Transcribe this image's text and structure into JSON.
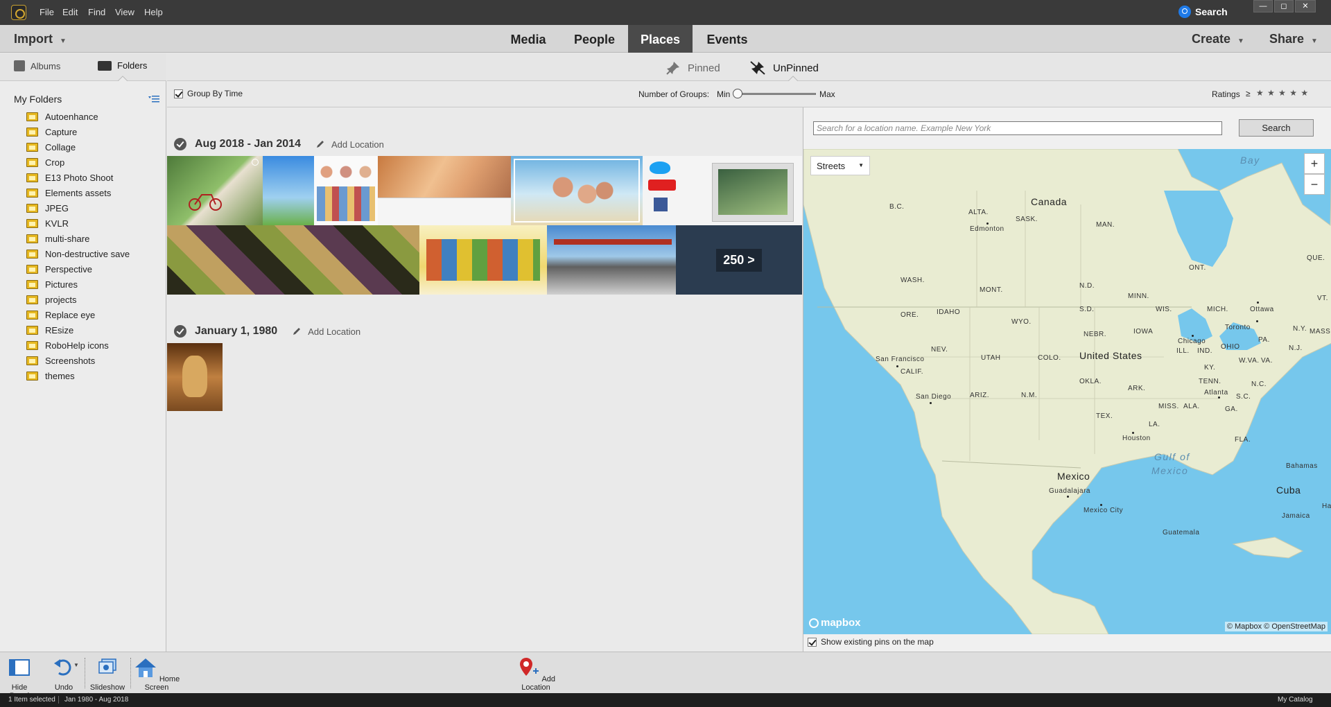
{
  "titlebar": {
    "menus": [
      "File",
      "Edit",
      "Find",
      "View",
      "Help"
    ],
    "search_label": "Search",
    "window_controls": [
      "—",
      "◻",
      "✕"
    ]
  },
  "navbar": {
    "import_label": "Import",
    "tabs": [
      "Media",
      "People",
      "Places",
      "Events"
    ],
    "active_tab": "Places",
    "create_label": "Create",
    "share_label": "Share"
  },
  "left_panel": {
    "tabs": [
      "Albums",
      "Folders"
    ],
    "active_tab": "Folders",
    "section_title": "My Folders",
    "folders": [
      "Autoenhance",
      "Capture",
      "Collage",
      "Crop",
      "E13 Photo Shoot",
      "Elements assets",
      "JPEG",
      "KVLR",
      "multi-share",
      "Non-destructive save",
      "Perspective",
      "Pictures",
      "projects",
      "Replace eye",
      "REsize",
      "RoboHelp icons",
      "Screenshots",
      "themes"
    ]
  },
  "subheader": {
    "pinned_label": "Pinned",
    "unpinned_label": "UnPinned",
    "active": "UnPinned"
  },
  "toolbar2": {
    "group_by_time_label": "Group By Time",
    "group_by_time_checked": true,
    "num_groups_label": "Number of Groups:",
    "min_label": "Min",
    "max_label": "Max",
    "slider_value": 0,
    "ratings_label": "Ratings",
    "ratings_op": "≥",
    "stars": "★ ★ ★ ★ ★"
  },
  "media": {
    "groups": [
      {
        "title": "Aug 2018 - Jan 2014",
        "add_location": "Add Location"
      },
      {
        "title": "January 1, 1980",
        "add_location": "Add Location"
      }
    ],
    "more_label": "250 >"
  },
  "map_panel": {
    "search_placeholder": "Search for a location name. Example New York",
    "search_button": "Search",
    "layer": "Streets",
    "zoom_in": "+",
    "zoom_out": "−",
    "labels": {
      "canada": "Canada",
      "united_states": "United States",
      "mexico": "Mexico",
      "cuba": "Cuba",
      "bay": "Bay",
      "gulf": "Gulf of",
      "gulf2": "Mexico",
      "bc": "B.C.",
      "alta": "ALTA.",
      "sask": "SASK.",
      "man": "MAN.",
      "ont": "ONT.",
      "que": "QUE.",
      "wash": "WASH.",
      "ore": "ORE.",
      "idaho": "IDAHO",
      "mont": "MONT.",
      "wyo": "WYO.",
      "nd": "N.D.",
      "sd": "S.D.",
      "minn": "MINN.",
      "wis": "WIS.",
      "mich": "MICH.",
      "iowa": "IOWA",
      "nebr": "NEBR.",
      "nev": "NEV.",
      "utah": "UTAH",
      "colo": "COLO.",
      "calif": "CALIF.",
      "ariz": "ARIZ.",
      "nm": "N.M.",
      "okla": "OKLA.",
      "tex": "TEX.",
      "ark": "ARK.",
      "la": "LA.",
      "miss": "MISS.",
      "ala": "ALA.",
      "ga": "GA.",
      "fla": "FLA.",
      "tenn": "TENN.",
      "ky": "KY.",
      "ill": "ILL.",
      "ind": "IND.",
      "ohio": "OHIO",
      "pa": "PA.",
      "ny": "N.Y.",
      "vt": "VT.",
      "mass": "MASS.",
      "nj": "N.J.",
      "wva": "W.VA.",
      "va": "VA.",
      "nc": "N.C.",
      "sc": "S.C.",
      "edmonton": "Edmonton",
      "chicago": "Chicago",
      "toronto": "Toronto",
      "ottawa": "Ottawa",
      "sf": "San Francisco",
      "sd_city": "San Diego",
      "atlanta": "Atlanta",
      "houston": "Houston",
      "guadalajara": "Guadalajara",
      "mexico_city": "Mexico City",
      "guatemala": "Guatemala",
      "bahamas": "Bahamas",
      "jamaica": "Jamaica",
      "haiti": "Haiti"
    },
    "brand": "mapbox",
    "attribution": "© Mapbox © OpenStreetMap",
    "show_pins_label": "Show existing pins on the map",
    "show_pins_checked": true
  },
  "bottombar": {
    "hide_panel": "Hide Panel",
    "undo": "Undo",
    "slideshow": "Slideshow",
    "home_screen": "Home Screen",
    "add_location": "Add Location"
  },
  "statusbar": {
    "selected": "1 Item selected",
    "range": "Jan 1980 - Aug 2018",
    "catalog": "My Catalog"
  },
  "colors": {
    "ocean": "#76c7ec",
    "land": "#e9ecd2",
    "active_tab_bg": "#4a4a4a",
    "folder_yellow": "#e6b820"
  }
}
